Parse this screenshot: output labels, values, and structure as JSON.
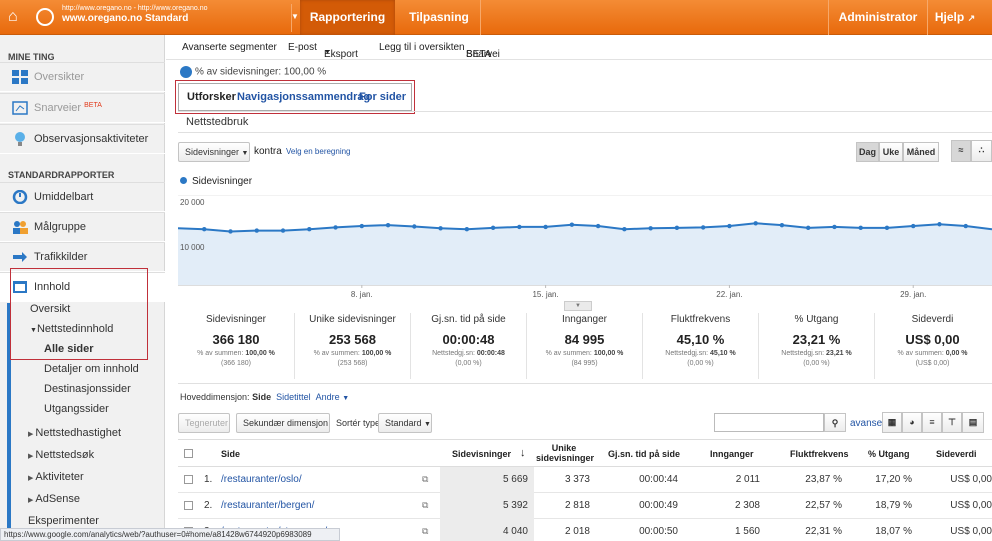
{
  "topbar": {
    "account_url": "http://www.oregano.no - http://www.oregano.no",
    "account_name": "www.oregano.no Standard",
    "tabs": [
      "Rapportering",
      "Tilpasning"
    ],
    "admin": "Administrator",
    "help": "Hjelp"
  },
  "sidebar": {
    "section1": "MINE TING",
    "my_items": [
      "Oversikter",
      "Snarveier",
      "Observasjonsaktiviteter"
    ],
    "beta": "BETA",
    "section2": "STANDARDRAPPORTER",
    "std_items": [
      "Umiddelbart",
      "Målgruppe",
      "Trafikkilder",
      "Innhold"
    ],
    "content_sub": [
      "Oversikt",
      "Nettstedinnhold",
      "Alle sider",
      "Detaljer om innhold",
      "Destinasjonssider",
      "Utgangssider"
    ],
    "content_more": [
      "Nettstedhastighet",
      "Nettstedsøk",
      "Aktiviteter",
      "AdSense",
      "Eksperimenter"
    ]
  },
  "toolbar": {
    "items": [
      "Avanserte segmenter",
      "E-post",
      "Eksport",
      "Legg til i oversikten",
      "Snarvei"
    ],
    "beta": "BETA"
  },
  "segment": "% av sidevisninger: 100,00 %",
  "subtabs": [
    "Utforsker",
    "Navigasjonssammendrag",
    "For sider"
  ],
  "nettstedbruk": "Nettstedbruk",
  "chart_controls": {
    "metric": "Sidevisninger",
    "kontra": "kontra",
    "velg": "Velg en beregning",
    "periods": [
      "Dag",
      "Uke",
      "Måned"
    ]
  },
  "chart_data": {
    "type": "line",
    "series": [
      {
        "name": "Sidevisninger",
        "values": [
          12600,
          12400,
          11900,
          12100,
          12100,
          12400,
          12800,
          13100,
          13300,
          13000,
          12600,
          12400,
          12700,
          12900,
          12900,
          13400,
          13100,
          12400,
          12600,
          12700,
          12800,
          13100,
          13700,
          13300,
          12700,
          12900,
          12700,
          12700,
          13100,
          13500,
          13100,
          12400
        ]
      }
    ],
    "x": [
      "1. jan.",
      "2. jan.",
      "3. jan.",
      "4. jan.",
      "5. jan.",
      "6. jan.",
      "7. jan.",
      "8. jan.",
      "9. jan.",
      "10. jan.",
      "11. jan.",
      "12. jan.",
      "13. jan.",
      "14. jan.",
      "15. jan.",
      "16. jan.",
      "17. jan.",
      "18. jan.",
      "19. jan.",
      "20. jan.",
      "21. jan.",
      "22. jan.",
      "23. jan.",
      "24. jan.",
      "25. jan.",
      "26. jan.",
      "27. jan.",
      "28. jan.",
      "29. jan.",
      "30. jan.",
      "31. jan.",
      "1. feb."
    ],
    "x_ticks": [
      "8. jan.",
      "15. jan.",
      "22. jan.",
      "29. jan."
    ],
    "y_ticks": [
      "20 000",
      "10 000"
    ],
    "ylim": [
      0,
      20000
    ],
    "grid": true,
    "legend": "top-left"
  },
  "metrics": [
    {
      "title": "Sidevisninger",
      "value": "366 180",
      "sub1": "% av summen: ",
      "sub1b": "100,00 %",
      "sub2": "(366 180)"
    },
    {
      "title": "Unike sidevisninger",
      "value": "253 568",
      "sub1": "% av summen: ",
      "sub1b": "100,00 %",
      "sub2": "(253 568)"
    },
    {
      "title": "Gj.sn. tid på side",
      "value": "00:00:48",
      "sub1": "Nettstedgj.sn: ",
      "sub1b": "00:00:48",
      "sub2": "(0,00 %)"
    },
    {
      "title": "Innganger",
      "value": "84 995",
      "sub1": "% av summen: ",
      "sub1b": "100,00 %",
      "sub2": "(84 995)"
    },
    {
      "title": "Fluktfrekvens",
      "value": "45,10 %",
      "sub1": "Nettstedgj.sn: ",
      "sub1b": "45,10 %",
      "sub2": "(0,00 %)"
    },
    {
      "title": "% Utgang",
      "value": "23,21 %",
      "sub1": "Nettstedgj.sn: ",
      "sub1b": "23,21 %",
      "sub2": "(0,00 %)"
    },
    {
      "title": "Sideverdi",
      "value": "US$ 0,00",
      "sub1": "% av summen: ",
      "sub1b": "0,00 %",
      "sub2": "(US$ 0,00)"
    }
  ],
  "table_ctrl": {
    "hoved": "Hoveddimensjon:",
    "side": "Side",
    "sidetittel": "Sidetittel",
    "andre": "Andre",
    "tegneruter": "Tegneruter",
    "sekundaer": "Sekundær dimensjon",
    "sorter": "Sortér type:",
    "standard": "Standard",
    "search_placeholder": "",
    "avansert": "avansert"
  },
  "table": {
    "headers": [
      "Side",
      "Sidevisninger",
      "Unike sidevisninger",
      "Gj.sn. tid på side",
      "Innganger",
      "Fluktfrekvens",
      "% Utgang",
      "Sideverdi"
    ],
    "rows": [
      {
        "n": "1.",
        "page": "/restauranter/oslo/",
        "pv": "5 669",
        "upv": "3 373",
        "time": "00:00:44",
        "ent": "2 011",
        "bounce": "23,87 %",
        "exit": "17,20 %",
        "val": "US$ 0,00"
      },
      {
        "n": "2.",
        "page": "/restauranter/bergen/",
        "pv": "5 392",
        "upv": "2 818",
        "time": "00:00:49",
        "ent": "2 308",
        "bounce": "22,57 %",
        "exit": "18,79 %",
        "val": "US$ 0,00"
      },
      {
        "n": "3.",
        "page": "/restauranter/stavanger/",
        "pv": "4 040",
        "upv": "2 018",
        "time": "00:00:50",
        "ent": "1 560",
        "bounce": "22,31 %",
        "exit": "18,07 %",
        "val": "US$ 0,00"
      }
    ]
  },
  "statusbar": "https://www.google.com/analytics/web/?authuser=0#home/a81428w6744920p6983089",
  "colors": {
    "orange": "#e86a0c",
    "blue": "#2b78c5",
    "fill": "#e2edf8",
    "red": "#c0303a"
  }
}
